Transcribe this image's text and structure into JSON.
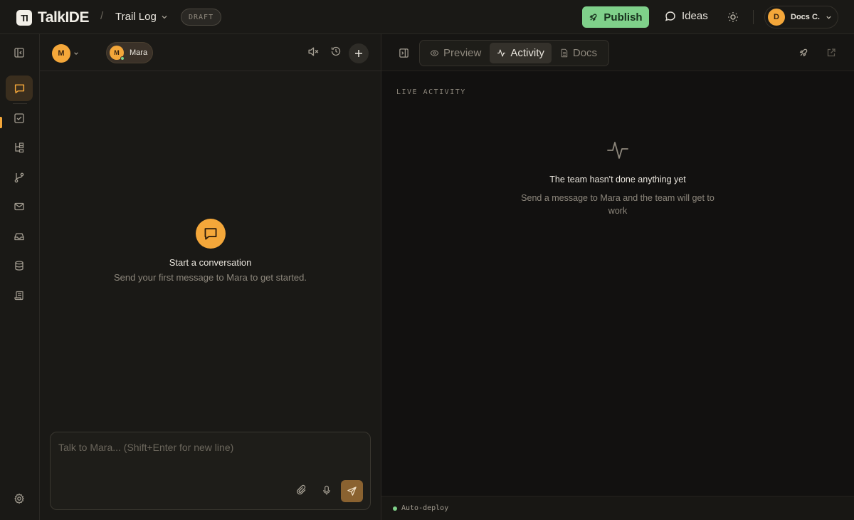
{
  "header": {
    "logo_mark": "TI",
    "logo_text": "TalkIDE",
    "breadcrumb_sep": "/",
    "project_name": "Trail Log",
    "status_badge": "DRAFT",
    "publish_label": "Publish",
    "ideas_label": "Ideas",
    "account_initial": "D",
    "account_name": "Docs C."
  },
  "sidebar": {
    "items": [
      {
        "icon": "panel-collapse-icon"
      },
      {
        "icon": "chat-icon",
        "active": true
      },
      {
        "icon": "checklist-icon"
      },
      {
        "icon": "tree-icon"
      },
      {
        "icon": "git-branch-icon"
      },
      {
        "icon": "mail-icon"
      },
      {
        "icon": "inbox-icon"
      },
      {
        "icon": "database-icon"
      },
      {
        "icon": "scroll-icon"
      },
      {
        "icon": "settings-icon"
      }
    ]
  },
  "chat": {
    "user_initial": "M",
    "agent_initial": "M",
    "agent_name": "Mara",
    "empty_title": "Start a conversation",
    "empty_subtitle": "Send your first message to Mara to get started.",
    "composer_placeholder": "Talk to Mara... (Shift+Enter for new line)"
  },
  "panel": {
    "tabs": [
      {
        "label": "Preview",
        "icon": "eye-icon"
      },
      {
        "label": "Activity",
        "icon": "activity-icon",
        "active": true
      },
      {
        "label": "Docs",
        "icon": "doc-icon"
      }
    ],
    "section_label": "LIVE ACTIVITY",
    "empty_title": "The team hasn't done anything yet",
    "empty_subtitle": "Send a message to Mara and the team will get to work",
    "status_text": "Auto-deploy"
  },
  "colors": {
    "accent": "#f4a73a",
    "publish": "#7fd08a",
    "background": "#1a1916"
  }
}
